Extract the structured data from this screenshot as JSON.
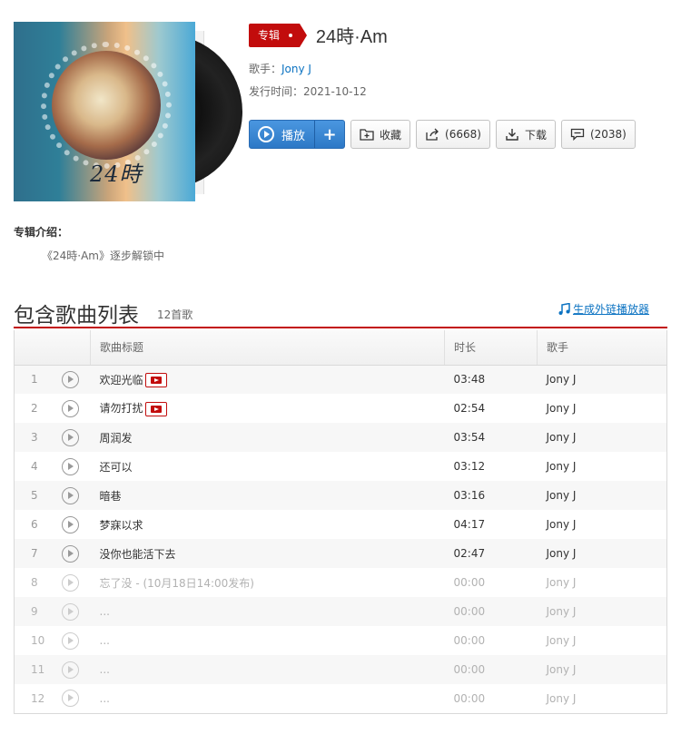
{
  "album": {
    "tag": "专辑",
    "title": "24時·Am",
    "cover_text": "24時",
    "artist_label": "歌手：",
    "artist": "Jony J",
    "date_label": "发行时间：",
    "date": "2021-10-12"
  },
  "actions": {
    "play_label": "播放",
    "add_label": "+",
    "collect_label": "收藏",
    "share_label": "(6668)",
    "download_label": "下载",
    "comment_label": "(2038)"
  },
  "intro": {
    "title": "专辑介绍：",
    "text": "《24時·Am》逐步解锁中"
  },
  "tracklist": {
    "heading": "包含歌曲列表",
    "count": "12首歌",
    "external_link": "生成外链播放器",
    "columns": [
      "",
      "歌曲标题",
      "时长",
      "歌手"
    ]
  },
  "tracks": [
    {
      "num": "1",
      "title": "欢迎光临",
      "mv": true,
      "duration": "03:48",
      "artist": "Jony J",
      "available": true
    },
    {
      "num": "2",
      "title": "请勿打扰",
      "mv": true,
      "duration": "02:54",
      "artist": "Jony J",
      "available": true
    },
    {
      "num": "3",
      "title": "周润发",
      "mv": false,
      "duration": "03:54",
      "artist": "Jony J",
      "available": true
    },
    {
      "num": "4",
      "title": "还可以",
      "mv": false,
      "duration": "03:12",
      "artist": "Jony J",
      "available": true
    },
    {
      "num": "5",
      "title": "暗巷",
      "mv": false,
      "duration": "03:16",
      "artist": "Jony J",
      "available": true
    },
    {
      "num": "6",
      "title": "梦寐以求",
      "mv": false,
      "duration": "04:17",
      "artist": "Jony J",
      "available": true
    },
    {
      "num": "7",
      "title": "没你也能活下去",
      "mv": false,
      "duration": "02:47",
      "artist": "Jony J",
      "available": true
    },
    {
      "num": "8",
      "title": "忘了没 - (10月18日14:00发布)",
      "mv": false,
      "duration": "00:00",
      "artist": "Jony J",
      "available": false
    },
    {
      "num": "9",
      "title": "...",
      "mv": false,
      "duration": "00:00",
      "artist": "Jony J",
      "available": false
    },
    {
      "num": "10",
      "title": "...",
      "mv": false,
      "duration": "00:00",
      "artist": "Jony J",
      "available": false
    },
    {
      "num": "11",
      "title": "...",
      "mv": false,
      "duration": "00:00",
      "artist": "Jony J",
      "available": false
    },
    {
      "num": "12",
      "title": "...",
      "mv": false,
      "duration": "00:00",
      "artist": "Jony J",
      "available": false
    }
  ],
  "colors": {
    "accent_red": "#c20c0c",
    "link_blue": "#0c73c2",
    "play_blue": "#2d78c6"
  },
  "icons": {
    "play": "play-circle-icon",
    "collect": "folder-plus-icon",
    "share": "share-icon",
    "download": "download-icon",
    "comment": "comment-icon",
    "mv": "mv-icon",
    "music_note": "music-note-icon"
  }
}
